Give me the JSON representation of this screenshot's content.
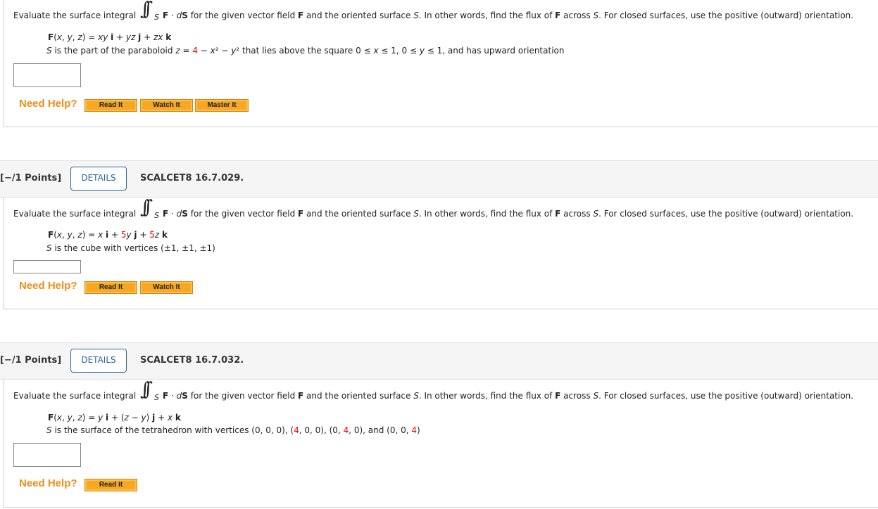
{
  "colors": {
    "accent": "#2a6496",
    "help": "#f28c18",
    "button": "#f7a823",
    "highlight": "#ee0000"
  },
  "intro": {
    "before": "Evaluate the surface integral",
    "sub": "S",
    "after_parts": [
      {
        "t": "F",
        "s": "b"
      },
      {
        "t": " · ",
        "s": ""
      },
      {
        "t": "d",
        "s": "i"
      },
      {
        "t": "S",
        "s": "b"
      },
      {
        "t": "  for the given vector field ",
        "s": ""
      },
      {
        "t": "F",
        "s": "b"
      },
      {
        "t": " and the oriented surface ",
        "s": ""
      },
      {
        "t": "S",
        "s": "i"
      },
      {
        "t": ". In other words, find the flux of ",
        "s": ""
      },
      {
        "t": "F",
        "s": "b"
      },
      {
        "t": " across ",
        "s": ""
      },
      {
        "t": "S",
        "s": "i"
      },
      {
        "t": ". For closed surfaces, use the positive (outward) orientation.",
        "s": ""
      }
    ]
  },
  "need_help": "Need Help?",
  "problems": [
    {
      "field": [
        {
          "t": "F",
          "s": "b"
        },
        {
          "t": "(",
          "s": ""
        },
        {
          "t": "x",
          "s": "i"
        },
        {
          "t": ", ",
          "s": ""
        },
        {
          "t": "y",
          "s": "i"
        },
        {
          "t": ", ",
          "s": ""
        },
        {
          "t": "z",
          "s": "i"
        },
        {
          "t": ") = ",
          "s": ""
        },
        {
          "t": "xy",
          "s": "i"
        },
        {
          "t": " ",
          "s": ""
        },
        {
          "t": "i",
          "s": "b"
        },
        {
          "t": " + ",
          "s": ""
        },
        {
          "t": "yz",
          "s": "i"
        },
        {
          "t": " ",
          "s": ""
        },
        {
          "t": "j",
          "s": "b"
        },
        {
          "t": " + ",
          "s": ""
        },
        {
          "t": "zx",
          "s": "i"
        },
        {
          "t": " ",
          "s": ""
        },
        {
          "t": "k",
          "s": "b"
        }
      ],
      "surface": [
        {
          "t": "S",
          "s": "i"
        },
        {
          "t": " is the part of the paraboloid  ",
          "s": ""
        },
        {
          "t": "z",
          "s": "i"
        },
        {
          "t": " = ",
          "s": ""
        },
        {
          "t": "4",
          "s": "red"
        },
        {
          "t": " − ",
          "s": ""
        },
        {
          "t": "x",
          "s": "i"
        },
        {
          "t": "² − ",
          "s": ""
        },
        {
          "t": "y",
          "s": "i"
        },
        {
          "t": "² that lies above the square 0 ≤ ",
          "s": ""
        },
        {
          "t": "x",
          "s": "i"
        },
        {
          "t": " ≤ 1, 0 ≤ ",
          "s": ""
        },
        {
          "t": "y",
          "s": "i"
        },
        {
          "t": " ≤ 1,  and has upward orientation",
          "s": ""
        }
      ],
      "answer": "",
      "buttons": [
        "Read It",
        "Watch It",
        "Master It"
      ]
    },
    {
      "points": "[−/1 Points]",
      "details": "DETAILS",
      "code": "SCALCET8 16.7.029.",
      "field": [
        {
          "t": "F",
          "s": "b"
        },
        {
          "t": "(",
          "s": ""
        },
        {
          "t": "x",
          "s": "i"
        },
        {
          "t": ", ",
          "s": ""
        },
        {
          "t": "y",
          "s": "i"
        },
        {
          "t": ", ",
          "s": ""
        },
        {
          "t": "z",
          "s": "i"
        },
        {
          "t": ") = ",
          "s": ""
        },
        {
          "t": "x",
          "s": "i"
        },
        {
          "t": " ",
          "s": ""
        },
        {
          "t": "i",
          "s": "b"
        },
        {
          "t": " + ",
          "s": ""
        },
        {
          "t": "5",
          "s": "red"
        },
        {
          "t": "y",
          "s": "i"
        },
        {
          "t": " ",
          "s": ""
        },
        {
          "t": "j",
          "s": "b"
        },
        {
          "t": " + ",
          "s": ""
        },
        {
          "t": "5",
          "s": "red"
        },
        {
          "t": "z",
          "s": "i"
        },
        {
          "t": " ",
          "s": ""
        },
        {
          "t": "k",
          "s": "b"
        }
      ],
      "surface": [
        {
          "t": "S",
          "s": "i"
        },
        {
          "t": " is the cube with vertices  (±1, ±1, ±1)",
          "s": ""
        }
      ],
      "answer": "",
      "buttons": [
        "Read It",
        "Watch It"
      ]
    },
    {
      "points": "[−/1 Points]",
      "details": "DETAILS",
      "code": "SCALCET8 16.7.032.",
      "field": [
        {
          "t": "F",
          "s": "b"
        },
        {
          "t": "(",
          "s": ""
        },
        {
          "t": "x",
          "s": "i"
        },
        {
          "t": ", ",
          "s": ""
        },
        {
          "t": "y",
          "s": "i"
        },
        {
          "t": ", ",
          "s": ""
        },
        {
          "t": "z",
          "s": "i"
        },
        {
          "t": ") = ",
          "s": ""
        },
        {
          "t": "y",
          "s": "i"
        },
        {
          "t": " ",
          "s": ""
        },
        {
          "t": "i",
          "s": "b"
        },
        {
          "t": " + (",
          "s": ""
        },
        {
          "t": "z",
          "s": "i"
        },
        {
          "t": " − ",
          "s": ""
        },
        {
          "t": "y",
          "s": "i"
        },
        {
          "t": ") ",
          "s": ""
        },
        {
          "t": "j",
          "s": "b"
        },
        {
          "t": " + ",
          "s": ""
        },
        {
          "t": "x",
          "s": "i"
        },
        {
          "t": " ",
          "s": ""
        },
        {
          "t": "k",
          "s": "b"
        }
      ],
      "surface": [
        {
          "t": "S",
          "s": "i"
        },
        {
          "t": " is the surface of the tetrahedron with vertices (0, 0, 0), (",
          "s": ""
        },
        {
          "t": "4",
          "s": "red"
        },
        {
          "t": ", 0, 0), (0, ",
          "s": ""
        },
        {
          "t": "4",
          "s": "red"
        },
        {
          "t": ", 0), and (0, 0, ",
          "s": ""
        },
        {
          "t": "4",
          "s": "red"
        },
        {
          "t": ")",
          "s": ""
        }
      ],
      "answer": "",
      "buttons": [
        "Read It"
      ]
    }
  ]
}
